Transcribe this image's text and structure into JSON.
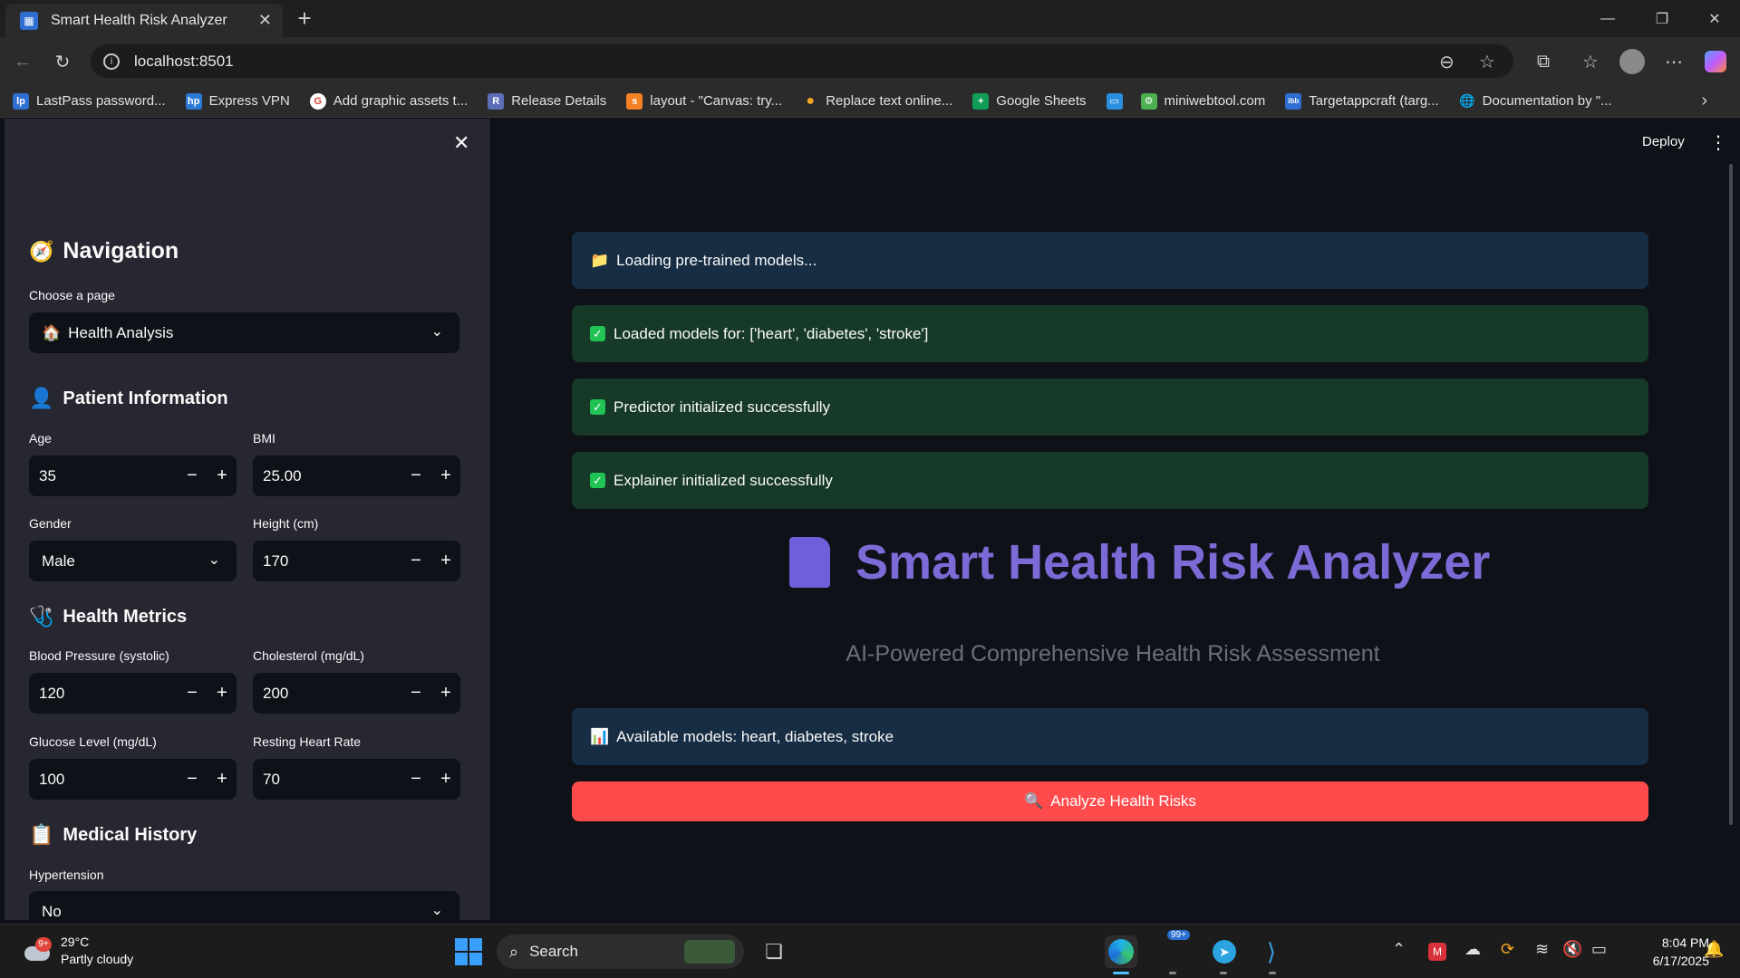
{
  "browser": {
    "tab_title": "Smart Health Risk Analyzer",
    "tab_close": "✕",
    "new_tab": "+",
    "url": "localhost:8501",
    "bookmarks": [
      {
        "label": "LastPass password...",
        "icon": "lastpass-icon",
        "color": "#2e6fd1",
        "glyph": "lp"
      },
      {
        "label": "Express VPN",
        "icon": "hp-icon",
        "color": "#2b7bd6",
        "glyph": "hp"
      },
      {
        "label": "Add graphic assets t...",
        "icon": "google-icon",
        "color": "#db4437",
        "glyph": "G"
      },
      {
        "label": "Release Details",
        "icon": "release-icon",
        "color": "#5a6fb8",
        "glyph": "R"
      },
      {
        "label": "layout - \"Canvas: try...",
        "icon": "stackoverflow-icon",
        "color": "#f48024",
        "glyph": "s"
      },
      {
        "label": "Replace text online...",
        "icon": "replace-icon",
        "color": "#f5a623",
        "glyph": "●"
      },
      {
        "label": "Google Sheets",
        "icon": "sheets-icon",
        "color": "#0f9d58",
        "glyph": "+"
      },
      {
        "label": "",
        "icon": "bookmark-app-icon",
        "color": "#2b8fe0",
        "glyph": "▭"
      },
      {
        "label": "miniwebtool.com",
        "icon": "miniwebtool-icon",
        "color": "#4caf50",
        "glyph": "⚙"
      },
      {
        "label": "Targetappcraft (targ...",
        "icon": "targetapp-icon",
        "color": "#2e6fd1",
        "glyph": "ibb"
      },
      {
        "label": "Documentation by \"...",
        "icon": "globe-icon",
        "color": "#2b2b2b",
        "glyph": "🌐"
      }
    ]
  },
  "sidebar": {
    "navigation_title": "Navigation",
    "choose_page_label": "Choose a page",
    "page_select_value": "Health Analysis",
    "patient_info_title": "Patient Information",
    "health_metrics_title": "Health Metrics",
    "medical_history_title": "Medical History",
    "fields": {
      "age_label": "Age",
      "age_value": "35",
      "bmi_label": "BMI",
      "bmi_value": "25.00",
      "gender_label": "Gender",
      "gender_value": "Male",
      "height_label": "Height (cm)",
      "height_value": "170",
      "bp_label": "Blood Pressure (systolic)",
      "bp_value": "120",
      "chol_label": "Cholesterol (mg/dL)",
      "chol_value": "200",
      "glucose_label": "Glucose Level (mg/dL)",
      "glucose_value": "100",
      "hr_label": "Resting Heart Rate",
      "hr_value": "70",
      "hypertension_label": "Hypertension",
      "hypertension_value": "No"
    },
    "minus": "−",
    "plus": "+"
  },
  "main": {
    "deploy_label": "Deploy",
    "alerts": {
      "loading": "Loading pre-trained models...",
      "loaded": "Loaded models for: ['heart', 'diabetes', 'stroke']",
      "predictor": "Predictor initialized successfully",
      "explainer": "Explainer initialized successfully",
      "available": "Available models: heart, diabetes, stroke"
    },
    "hero_title": "Smart Health Risk Analyzer",
    "hero_subtitle": "AI-Powered Comprehensive Health Risk Assessment",
    "analyze_button": "Analyze Health Risks"
  },
  "taskbar": {
    "temperature": "29°C",
    "weather": "Partly cloudy",
    "weather_badge": "9+",
    "search_label": "Search",
    "telegram_badge": "99+",
    "time": "8:04 PM",
    "date": "6/17/2025"
  },
  "colors": {
    "primary_button": "#ff4b4b",
    "info_alert": "#172d43",
    "success_alert": "#173928",
    "hero_title": "#7c6bd6"
  }
}
